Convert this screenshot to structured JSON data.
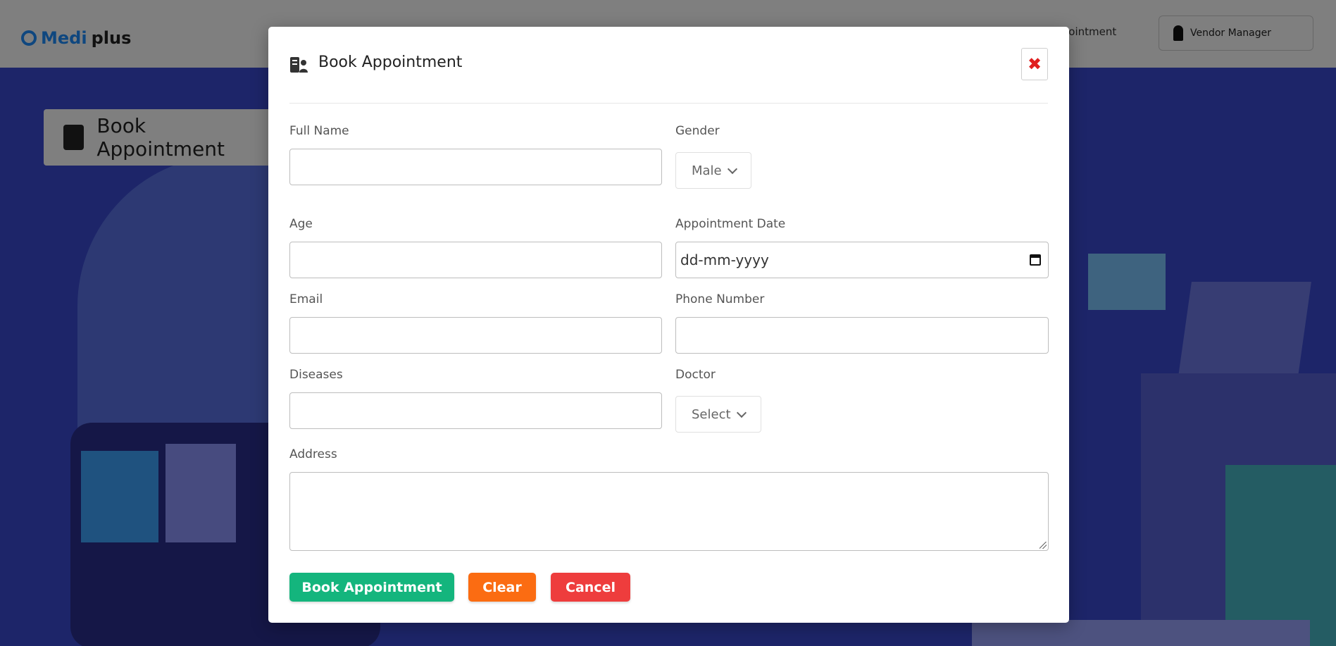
{
  "background": {
    "logo_text": "Medi",
    "logo_text_2": "plus",
    "nav_link": "Appointment",
    "user_label": "Vendor Manager",
    "page_card_title": "Book Appointment"
  },
  "modal": {
    "title": "Book Appointment",
    "close_label": "✖",
    "fields": {
      "full_name": {
        "label": "Full Name",
        "value": ""
      },
      "gender": {
        "label": "Gender",
        "selected": "Male"
      },
      "age": {
        "label": "Age",
        "value": ""
      },
      "appointment_date": {
        "label": "Appointment Date",
        "placeholder": "dd-mm-yyyy"
      },
      "email": {
        "label": "Email",
        "value": ""
      },
      "phone_number": {
        "label": "Phone Number",
        "value": ""
      },
      "diseases": {
        "label": "Diseases",
        "value": ""
      },
      "doctor": {
        "label": "Doctor",
        "selected": "Select"
      },
      "address": {
        "label": "Address",
        "value": ""
      }
    },
    "buttons": {
      "book": "Book Appointment",
      "clear": "Clear",
      "cancel": "Cancel"
    }
  },
  "colors": {
    "book_button": "#14b57d",
    "clear_button": "#fb6c12",
    "cancel_button": "#ee3d3d",
    "close_icon": "#e01e1e",
    "background_accent": "#3a4bd3"
  },
  "icons": {
    "title_icon": "doctor-clipboard-icon",
    "close_icon": "close-icon",
    "calendar_icon": "calendar-icon",
    "chevron_icon": "chevron-down-icon"
  }
}
